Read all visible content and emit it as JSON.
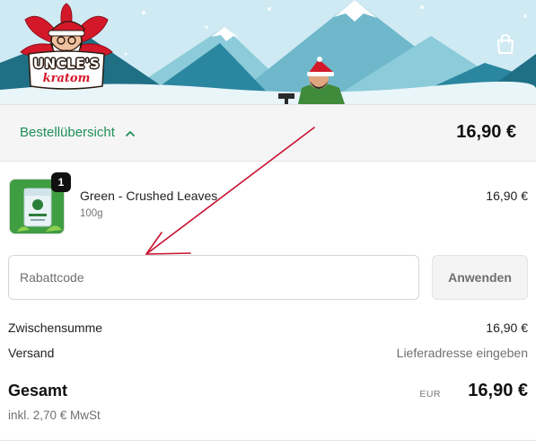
{
  "brand": {
    "name_line1": "UNCLE'S",
    "name_line2": "kratom",
    "colors": {
      "red": "#d3182a",
      "green": "#1f8f55",
      "sky": "#cde9f2"
    }
  },
  "header": {
    "cart_icon": "shopping-bag-icon"
  },
  "summary": {
    "toggle_label": "Bestellübersicht",
    "toggle_icon": "chevron-up-icon",
    "total": "16,90 €"
  },
  "cart": {
    "items": [
      {
        "quantity": "1",
        "name": "Green - Crushed Leaves",
        "variant": "100g",
        "price": "16,90 €"
      }
    ]
  },
  "discount": {
    "placeholder": "Rabattcode",
    "apply_label": "Anwenden"
  },
  "totals": {
    "subtotal_label": "Zwischensumme",
    "subtotal_value": "16,90 €",
    "shipping_label": "Versand",
    "shipping_value": "Lieferadresse eingeben",
    "total_label": "Gesamt",
    "currency": "EUR",
    "total_value": "16,90 €",
    "tax_note": "inkl. 2,70 € MwSt"
  }
}
